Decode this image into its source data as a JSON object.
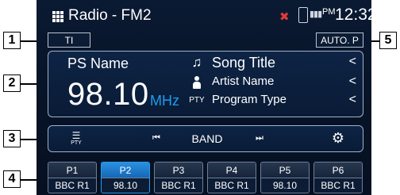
{
  "callouts": [
    "1",
    "2",
    "3",
    "4",
    "5"
  ],
  "header": {
    "menu_icon": "grid-icon",
    "title": "Radio - FM2",
    "mute_icon": "speaker-muted-icon",
    "phone_icon": "phone-icon",
    "signal_icon": "signal-bars-icon",
    "ampm": "PM",
    "time": "12:32"
  },
  "badges": {
    "ti": "TI",
    "auto_preset": "AUTO. P"
  },
  "station": {
    "ps_name": "PS Name",
    "frequency": "98.10",
    "unit": "MHz",
    "song_title": "Song Title",
    "artist_name": "Artist Name",
    "pty_label": "PTY",
    "program_type": "Program Type",
    "chevron": "<"
  },
  "controls": {
    "pty_search_label": "PTY",
    "prev_glyph": "⏮",
    "band_label": "BAND",
    "next_glyph": "⏭",
    "settings_glyph": "⚙"
  },
  "presets": [
    {
      "label": "P1",
      "value": "BBC R1",
      "active": false
    },
    {
      "label": "P2",
      "value": "98.10",
      "active": true
    },
    {
      "label": "P3",
      "value": "BBC R1",
      "active": false
    },
    {
      "label": "P4",
      "value": "BBC R1",
      "active": false
    },
    {
      "label": "P5",
      "value": "98.10",
      "active": false
    },
    {
      "label": "P6",
      "value": "BBC R1",
      "active": false
    }
  ],
  "colors": {
    "accent": "#1e9cf0",
    "background": "#081428",
    "mute": "#e03a3a"
  }
}
